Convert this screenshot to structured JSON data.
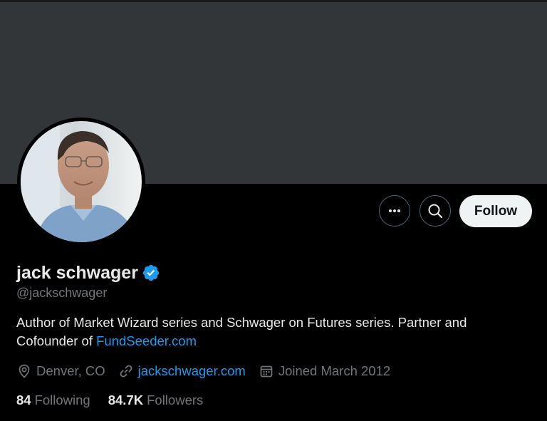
{
  "profile": {
    "display_name": "jack schwager",
    "handle": "@jackschwager",
    "bio_text": "Author of Market Wizard series and Schwager on Futures series. Partner and Cofounder of ",
    "bio_link": "FundSeeder.com",
    "location": "Denver, CO",
    "website": "jackschwager.com",
    "joined": "Joined March 2012",
    "following_count": "84",
    "following_label": "Following",
    "followers_count": "84.7K",
    "followers_label": "Followers"
  },
  "actions": {
    "follow_label": "Follow",
    "more_icon": "more-horizontal-icon",
    "search_icon": "search-icon"
  },
  "icons": {
    "verified": "verified-badge-icon",
    "location": "location-pin-icon",
    "link": "link-icon",
    "calendar": "calendar-icon"
  },
  "colors": {
    "background": "#000000",
    "banner": "#333639",
    "accent": "#1d9bf0",
    "text_primary": "#e7e9ea",
    "text_secondary": "#71767b",
    "follow_button_bg": "#eff3f4"
  }
}
